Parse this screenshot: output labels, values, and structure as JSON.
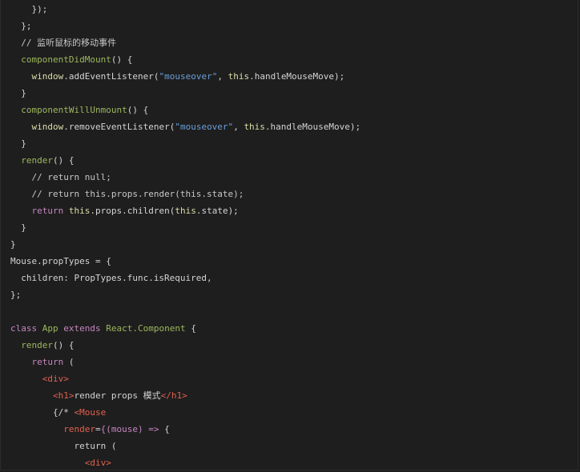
{
  "colors": {
    "background": "#1e1e1e",
    "plain": "#d4d4d4",
    "keyword": "#c586c0",
    "this": "#dcdcaa",
    "method": "#9cb75c",
    "string": "#6a9fd9",
    "tag": "#e0604f"
  },
  "code_lines": [
    {
      "indent": 4,
      "tokens": [
        {
          "t": "});",
          "c": "plain"
        }
      ]
    },
    {
      "indent": 2,
      "tokens": [
        {
          "t": "};",
          "c": "plain"
        }
      ]
    },
    {
      "indent": 2,
      "tokens": [
        {
          "t": "// 监听鼠标的移动事件",
          "c": "comment"
        }
      ]
    },
    {
      "indent": 2,
      "tokens": [
        {
          "t": "componentDidMount",
          "c": "method"
        },
        {
          "t": "() {",
          "c": "plain"
        }
      ]
    },
    {
      "indent": 4,
      "tokens": [
        {
          "t": "window",
          "c": "this"
        },
        {
          "t": ".addEventListener(",
          "c": "plain"
        },
        {
          "t": "\"mouseover\"",
          "c": "string"
        },
        {
          "t": ", ",
          "c": "plain"
        },
        {
          "t": "this",
          "c": "this"
        },
        {
          "t": ".handleMouseMove);",
          "c": "plain"
        }
      ]
    },
    {
      "indent": 2,
      "tokens": [
        {
          "t": "}",
          "c": "plain"
        }
      ]
    },
    {
      "indent": 2,
      "tokens": [
        {
          "t": "componentWillUnmount",
          "c": "method"
        },
        {
          "t": "() {",
          "c": "plain"
        }
      ]
    },
    {
      "indent": 4,
      "tokens": [
        {
          "t": "window",
          "c": "this"
        },
        {
          "t": ".removeEventListener(",
          "c": "plain"
        },
        {
          "t": "\"mouseover\"",
          "c": "string"
        },
        {
          "t": ", ",
          "c": "plain"
        },
        {
          "t": "this",
          "c": "this"
        },
        {
          "t": ".handleMouseMove);",
          "c": "plain"
        }
      ]
    },
    {
      "indent": 2,
      "tokens": [
        {
          "t": "}",
          "c": "plain"
        }
      ]
    },
    {
      "indent": 2,
      "tokens": [
        {
          "t": "render",
          "c": "method"
        },
        {
          "t": "() {",
          "c": "plain"
        }
      ]
    },
    {
      "indent": 4,
      "tokens": [
        {
          "t": "// return null;",
          "c": "comment"
        }
      ]
    },
    {
      "indent": 4,
      "tokens": [
        {
          "t": "// return this.props.render(this.state);",
          "c": "comment"
        }
      ]
    },
    {
      "indent": 4,
      "tokens": [
        {
          "t": "return ",
          "c": "keyword"
        },
        {
          "t": "this",
          "c": "this"
        },
        {
          "t": ".props.children(",
          "c": "plain"
        },
        {
          "t": "this",
          "c": "this"
        },
        {
          "t": ".state);",
          "c": "plain"
        }
      ]
    },
    {
      "indent": 2,
      "tokens": [
        {
          "t": "}",
          "c": "plain"
        }
      ]
    },
    {
      "indent": 0,
      "tokens": [
        {
          "t": "}",
          "c": "plain"
        }
      ]
    },
    {
      "indent": 0,
      "tokens": [
        {
          "t": "Mouse.propTypes = {",
          "c": "plain"
        }
      ]
    },
    {
      "indent": 2,
      "tokens": [
        {
          "t": "children: PropTypes.func.isRequired,",
          "c": "plain"
        }
      ]
    },
    {
      "indent": 0,
      "tokens": [
        {
          "t": "};",
          "c": "plain"
        }
      ]
    },
    {
      "indent": 0,
      "tokens": []
    },
    {
      "indent": 0,
      "tokens": [
        {
          "t": "class ",
          "c": "keyword"
        },
        {
          "t": "App ",
          "c": "classname"
        },
        {
          "t": "extends ",
          "c": "keyword"
        },
        {
          "t": "React.Component",
          "c": "classname"
        },
        {
          "t": " {",
          "c": "plain"
        }
      ]
    },
    {
      "indent": 2,
      "tokens": [
        {
          "t": "render",
          "c": "method"
        },
        {
          "t": "() {",
          "c": "plain"
        }
      ]
    },
    {
      "indent": 4,
      "tokens": [
        {
          "t": "return",
          "c": "keyword"
        },
        {
          "t": " (",
          "c": "plain"
        }
      ]
    },
    {
      "indent": 6,
      "tokens": [
        {
          "t": "<div>",
          "c": "tag"
        }
      ]
    },
    {
      "indent": 8,
      "tokens": [
        {
          "t": "<h1>",
          "c": "tag"
        },
        {
          "t": "render props 模式",
          "c": "plain"
        },
        {
          "t": "</h1>",
          "c": "tag"
        }
      ]
    },
    {
      "indent": 8,
      "tokens": [
        {
          "t": "{/* ",
          "c": "plain"
        },
        {
          "t": "<Mouse",
          "c": "tag"
        }
      ]
    },
    {
      "indent": 10,
      "tokens": [
        {
          "t": "render",
          "c": "attr"
        },
        {
          "t": "=",
          "c": "plain"
        },
        {
          "t": "{(mouse) => ",
          "c": "keyword"
        },
        {
          "t": "{",
          "c": "plain"
        }
      ]
    },
    {
      "indent": 12,
      "tokens": [
        {
          "t": "return (",
          "c": "plain"
        }
      ]
    },
    {
      "indent": 14,
      "tokens": [
        {
          "t": "<div>",
          "c": "tag"
        }
      ]
    }
  ]
}
